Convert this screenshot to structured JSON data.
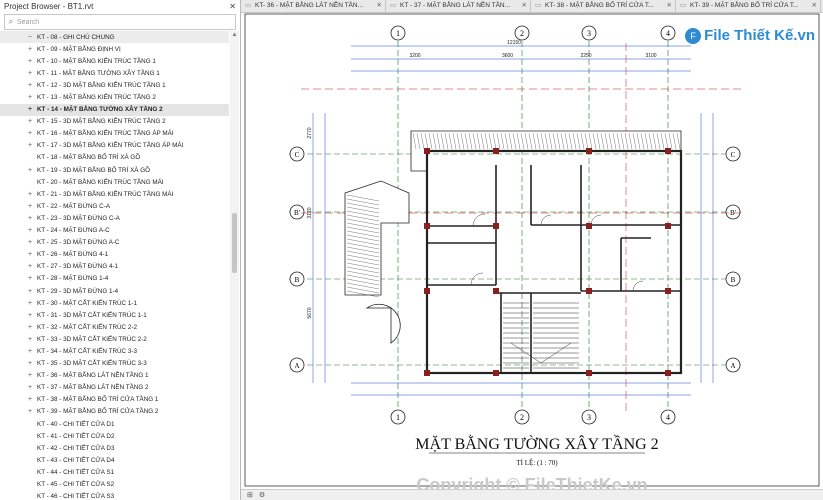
{
  "browser": {
    "title": "Project Browser - BT1.rvt",
    "close": "✕",
    "search_placeholder": "Search",
    "scroll_up": "▲",
    "items": [
      {
        "label": "KT - 08 - GHI CHÚ CHUNG",
        "exp": "−",
        "state": "hover"
      },
      {
        "label": "KT - 09 - MẶT BẰNG ĐỊNH VỊ",
        "exp": "+",
        "state": ""
      },
      {
        "label": "KT - 10 - MẶT BẰNG KIẾN TRÚC TẦNG 1",
        "exp": "+",
        "state": ""
      },
      {
        "label": "KT - 11 - MẶT BẰNG TƯỜNG XÂY TẦNG 1",
        "exp": "+",
        "state": ""
      },
      {
        "label": "KT - 12 - 3D MẶT BẰNG KIẾN TRÚC TẦNG 1",
        "exp": "+",
        "state": ""
      },
      {
        "label": "KT - 13 - MẶT BẰNG KIẾN TRÚC TẦNG 2",
        "exp": "+",
        "state": ""
      },
      {
        "label": "KT - 14 - MẶT BẰNG TƯỜNG XÂY TẦNG 2",
        "exp": "+",
        "state": "sel"
      },
      {
        "label": "KT - 15 - 3D MẶT BẰNG KIẾN TRÚC TẦNG 2",
        "exp": "+",
        "state": ""
      },
      {
        "label": "KT - 16 - MẶT BẰNG KIẾN TRÚC TẦNG ÁP MÁI",
        "exp": "+",
        "state": ""
      },
      {
        "label": "KT - 17 - 3D MẶT BẰNG KIẾN TRÚC TẦNG ÁP MÁI",
        "exp": "+",
        "state": ""
      },
      {
        "label": "KT - 18 - MẶT BẰNG BỐ TRÍ XÀ GỒ",
        "exp": "",
        "state": ""
      },
      {
        "label": "KT - 19 - 3D MẶT BẰNG BỐ TRÍ XÀ GỒ",
        "exp": "+",
        "state": ""
      },
      {
        "label": "KT - 20 - MẶT BẰNG KIẾN TRÚC TẦNG MÁI",
        "exp": "",
        "state": ""
      },
      {
        "label": "KT - 21 - 3D MẶT BẰNG KIẾN TRÚC TẦNG MÁI",
        "exp": "+",
        "state": ""
      },
      {
        "label": "KT - 22 - MẶT ĐỨNG C-A",
        "exp": "+",
        "state": ""
      },
      {
        "label": "KT - 23 - 3D MẶT ĐỨNG C-A",
        "exp": "+",
        "state": ""
      },
      {
        "label": "KT - 24 - MẶT ĐỨNG A-C",
        "exp": "+",
        "state": ""
      },
      {
        "label": "KT - 25 - 3D MẶT ĐỨNG A-C",
        "exp": "+",
        "state": ""
      },
      {
        "label": "KT - 26 - MẶT ĐỨNG 4-1",
        "exp": "+",
        "state": ""
      },
      {
        "label": "KT - 27 - 3D MẶT ĐỨNG 4-1",
        "exp": "+",
        "state": ""
      },
      {
        "label": "KT - 28 - MẶT ĐỨNG 1-4",
        "exp": "+",
        "state": ""
      },
      {
        "label": "KT - 29 - 3D MẶT ĐỨNG 1-4",
        "exp": "+",
        "state": ""
      },
      {
        "label": "KT - 30 - MẶT CẮT KIẾN TRÚC 1-1",
        "exp": "+",
        "state": ""
      },
      {
        "label": "KT - 31 - 3D MẶT CẮT KIẾN TRÚC 1-1",
        "exp": "+",
        "state": ""
      },
      {
        "label": "KT - 32 - MẶT CẮT KIẾN TRÚC 2-2",
        "exp": "+",
        "state": ""
      },
      {
        "label": "KT - 33 - 3D MẶT CẮT KIẾN TRÚC 2-2",
        "exp": "+",
        "state": ""
      },
      {
        "label": "KT - 34 - MẶT CẮT KIẾN TRÚC 3-3",
        "exp": "+",
        "state": ""
      },
      {
        "label": "KT - 35 - 3D MẶT CẮT KIẾN TRÚC 3-3",
        "exp": "+",
        "state": ""
      },
      {
        "label": "KT - 36 - MẶT BẰNG LÁT NỀN TẦNG 1",
        "exp": "+",
        "state": ""
      },
      {
        "label": "KT - 37 - MẶT BẰNG LÁT NỀN TẦNG 2",
        "exp": "+",
        "state": ""
      },
      {
        "label": "KT - 38 - MẶT BẰNG BỐ TRÍ CỬA TẦNG 1",
        "exp": "+",
        "state": ""
      },
      {
        "label": "KT - 39 - MẶT BẰNG BỐ TRÍ CỬA TẦNG 2",
        "exp": "+",
        "state": ""
      },
      {
        "label": "KT - 40 - CHI TIẾT CỬA D1",
        "exp": "",
        "state": ""
      },
      {
        "label": "KT - 41 - CHI TIẾT CỬA D2",
        "exp": "",
        "state": ""
      },
      {
        "label": "KT - 42 - CHI TIẾT CỬA D3",
        "exp": "",
        "state": ""
      },
      {
        "label": "KT - 43 - CHI TIẾT CỬA D4",
        "exp": "",
        "state": ""
      },
      {
        "label": "KT - 44 - CHI TIẾT CỬA S1",
        "exp": "",
        "state": ""
      },
      {
        "label": "KT - 45 - CHI TIẾT CỬA S2",
        "exp": "",
        "state": ""
      },
      {
        "label": "KT - 46 - CHI TIẾT CỬA S3",
        "exp": "",
        "state": ""
      }
    ]
  },
  "tabs": [
    {
      "label": "KT- 36 - MẶT BẰNG LÁT NỀN TẦN..."
    },
    {
      "label": "KT - 37 - MẶT BẰNG LÁT NỀN TẦN..."
    },
    {
      "label": "KT- 38 - MẶT BẰNG BỐ TRÍ CỬA T..."
    },
    {
      "label": "KT- 39 - MẶT BẰNG BỐ TRÍ CỬA T..."
    }
  ],
  "tab_close": "✕",
  "drawing": {
    "title": "MẶT BẰNG TƯỜNG XÂY TẦNG 2",
    "scale": "TỈ LỆ: (1 : 70)",
    "grid_top": [
      "1",
      "2",
      "3",
      "4"
    ],
    "grid_side": [
      "C",
      "B'",
      "B",
      "A"
    ],
    "dim_total": "12150",
    "dim_segments": [
      "3200",
      "3600",
      "2250",
      "3100"
    ],
    "dim_side": [
      "2770",
      "3120",
      "5670"
    ]
  },
  "watermark": {
    "logo": "File Thiết Kế.vn",
    "copyright": "Copyright © FileThietKe.vn"
  },
  "status": {
    "scale_icon": "⊞"
  },
  "colors": {
    "grid_line": "#1b7a1b",
    "dim": "#1e4fd6",
    "wall": "#222222",
    "accent": "#c41e1e"
  }
}
